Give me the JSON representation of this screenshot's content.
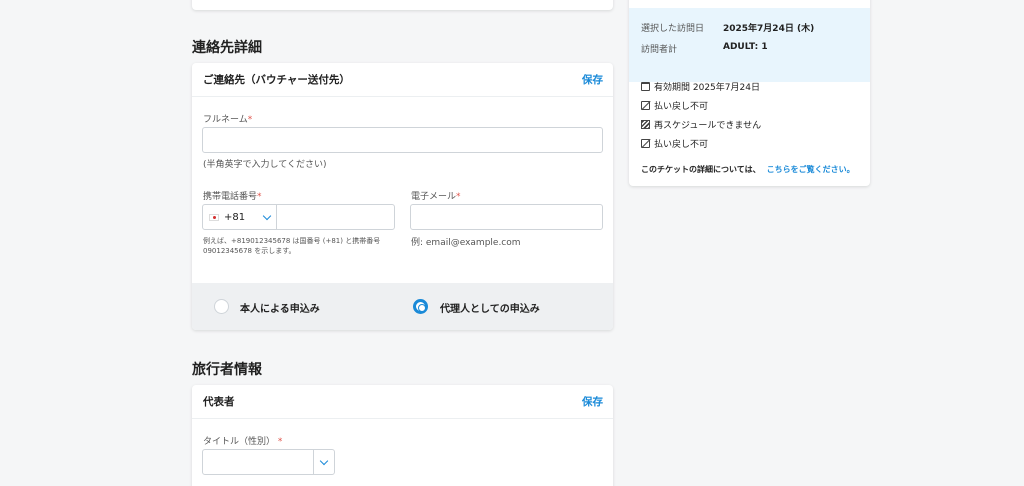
{
  "contact": {
    "section_title": "連絡先詳細",
    "card_title": "ご連絡先（バウチャー送付先）",
    "save_label": "保存",
    "fullname_label": "フルネーム",
    "required_mark": "*",
    "fullname_value": "",
    "fullname_hint": "(半角英字で入力してください)",
    "phone_label": "携帯電話番号",
    "phone_country_code": "+81",
    "phone_value": "",
    "phone_hint": "例えば、+819012345678 は国番号 (+81) と携帯番号 09012345678 を示します。",
    "email_label": "電子メール",
    "email_value": "",
    "email_hint": "例: email@example.com",
    "radio_self": "本人による申込み",
    "radio_agent": "代理人としての申込み",
    "selected_radio": "radio_agent"
  },
  "traveler": {
    "section_title": "旅行者情報",
    "card_title": "代表者",
    "save_label": "保存",
    "title_label": "タイトル（性別）",
    "required_mark": "*",
    "title_value": ""
  },
  "summary": {
    "visit_date_label": "選択した訪問日",
    "visit_date_value": "2025年7月24日 (木)",
    "visitors_label": "訪問者計",
    "visitors_value": "ADULT: 1",
    "validity": "有効期間 2025年7月24日",
    "nonrefundable_1": "払い戻し不可",
    "no_reschedule": "再スケジュールできません",
    "nonrefundable_2": "払い戻し不可",
    "detail_text": "このチケットの詳細については、",
    "detail_link": "こちらをご覧ください。"
  },
  "colors": {
    "accent": "#1a8ad8",
    "required": "#e0554c",
    "summary_band": "#e8f5fd"
  },
  "icons": [
    "calendar-icon",
    "money-off-icon",
    "schedule-off-icon",
    "chevron-down-icon",
    "japan-flag-icon"
  ]
}
